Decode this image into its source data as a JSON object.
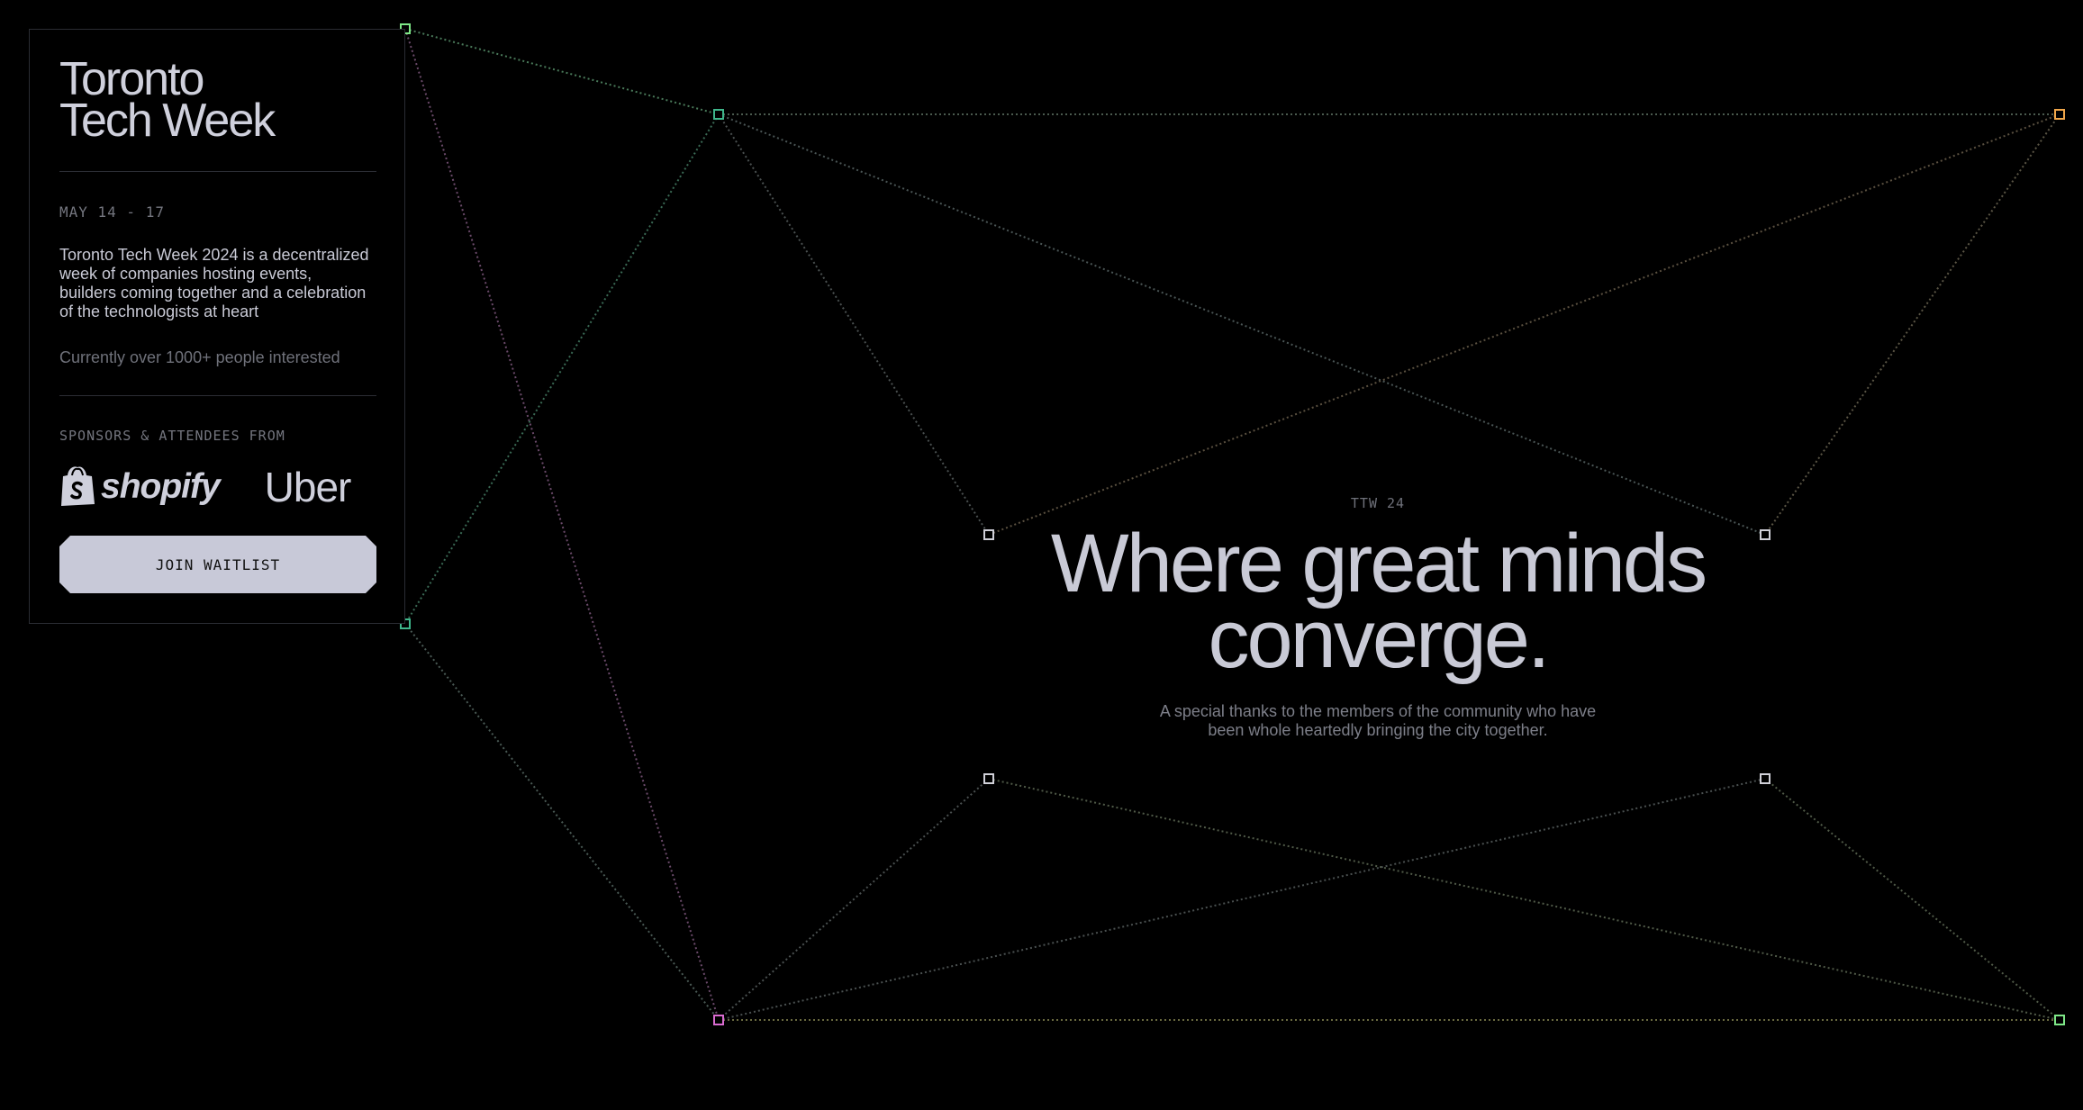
{
  "sidebar": {
    "title": "Toronto\nTech Week",
    "dates": "MAY 14 - 17",
    "description": "Toronto Tech Week 2024 is a decentralized week of companies hosting events, builders coming together and a celebration of the technologists at heart",
    "interest": "Currently over 1000+ people interested",
    "sponsors_label": "SPONSORS & ATTENDEES FROM",
    "sponsors": [
      {
        "name": "shopify",
        "icon": "shopify-bag-icon"
      },
      {
        "name": "Uber"
      }
    ],
    "join_button": "JOIN WAITLIST"
  },
  "hero": {
    "tag": "TTW 24",
    "title": "Where great minds\nconverge.",
    "subtitle": "A special thanks to the members of the community who have\nbeen whole heartedly bringing the city together."
  },
  "colors": {
    "background": "#000000",
    "text": "#c9cad6",
    "muted": "#74767f",
    "button": "#c8c9d8",
    "node_green": "#7ee787",
    "node_teal": "#3fb68b",
    "node_orange": "#f0a64a",
    "node_pink": "#d96bd0",
    "node_white": "#d0d0d8"
  }
}
